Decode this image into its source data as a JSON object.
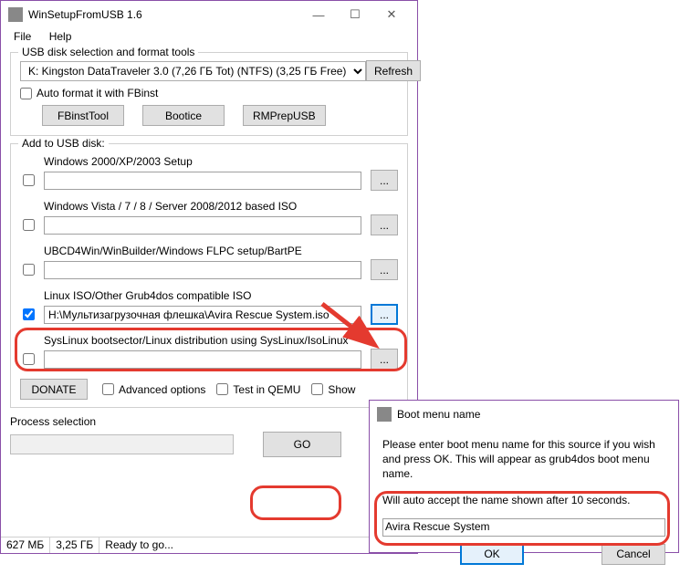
{
  "main": {
    "title": "WinSetupFromUSB 1.6",
    "menu": {
      "file": "File",
      "help": "Help"
    },
    "grp1_title": "USB disk selection and format tools",
    "drive_selected": "K: Kingston DataTraveler 3.0 (7,26 ГБ Tot) (NTFS) (3,25 ГБ Free)",
    "refresh": "Refresh",
    "autoformat_label": "Auto format it with FBinst",
    "tool_btns": {
      "fbinst": "FBinstTool",
      "bootice": "Bootice",
      "rmprep": "RMPrepUSB"
    },
    "grp2_title": "Add to USB disk:",
    "entries": [
      {
        "label": "Windows 2000/XP/2003 Setup",
        "value": "",
        "checked": false
      },
      {
        "label": "Windows Vista / 7 / 8 / Server 2008/2012 based ISO",
        "value": "",
        "checked": false
      },
      {
        "label": "UBCD4Win/WinBuilder/Windows FLPC setup/BartPE",
        "value": "",
        "checked": false
      },
      {
        "label": "Linux ISO/Other Grub4dos compatible ISO",
        "value": "H:\\Мультизагрузочная флешка\\Avira Rescue System.iso",
        "checked": true
      },
      {
        "label": "SysLinux bootsector/Linux distribution using SysLinux/IsoLinux",
        "value": "",
        "checked": false
      }
    ],
    "dots": "...",
    "donate": "DONATE",
    "adv_opts": "Advanced options",
    "test_qemu": "Test in QEMU",
    "show_log": "Show",
    "proc_label": "Process selection",
    "go": "GO",
    "status": {
      "used": "627 МБ",
      "free": "3,25 ГБ",
      "msg": "Ready to go..."
    }
  },
  "dlg": {
    "title": "Boot menu name",
    "line1": "Please enter boot menu name for this source if you wish and press OK. This will appear as grub4dos boot menu name.",
    "line2": "Will auto accept the name shown after 10 seconds.",
    "input_value": "Avira Rescue System",
    "ok": "OK",
    "cancel": "Cancel"
  }
}
